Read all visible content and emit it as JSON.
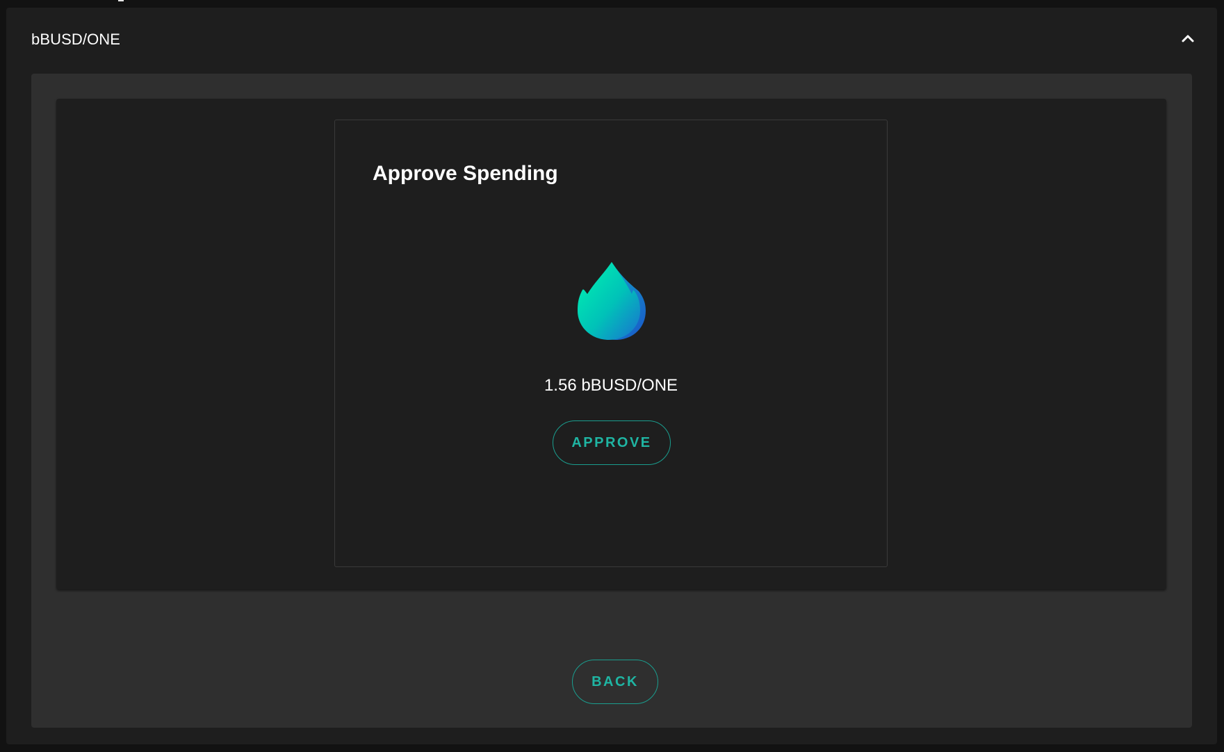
{
  "accordion": {
    "title": "bBUSD/ONE",
    "expand_icon": "chevron-up-icon"
  },
  "approve_dialog": {
    "title": "Approve Spending",
    "token_icon": "water-drop-icon",
    "amount_text": "1.56 bBUSD/ONE",
    "approve_label": "APPROVE"
  },
  "footer": {
    "back_label": "BACK"
  },
  "colors": {
    "background": "#121212",
    "surface": "#1e1e1e",
    "panel": "#2f2f2f",
    "accent": "#1fb5a3",
    "drop_gradient_start": "#00f0b0",
    "drop_gradient_end": "#1e6fd0"
  }
}
